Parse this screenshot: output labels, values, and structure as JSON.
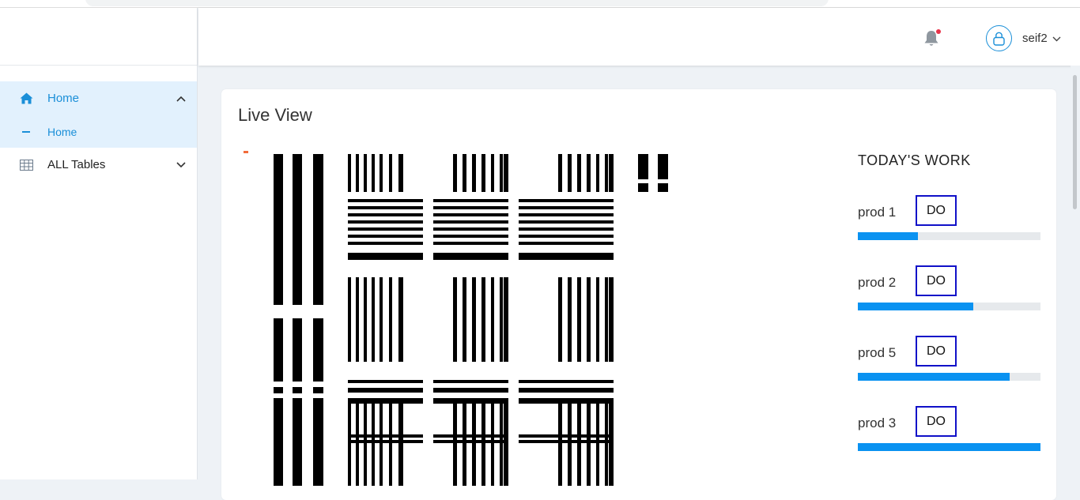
{
  "colors": {
    "accent": "#1a8fd8",
    "progress": "#0a92f1",
    "do_border": "#1010c8",
    "marker": "#f26b3a"
  },
  "sidebar": {
    "items": [
      {
        "label": "Home",
        "icon": "home-icon",
        "expanded": true,
        "children": [
          {
            "label": "Home"
          }
        ]
      },
      {
        "label": "ALL Tables",
        "icon": "table-icon",
        "expanded": false
      }
    ]
  },
  "topbar": {
    "user": {
      "name": "seif2"
    },
    "notifications": {
      "icon": "bell-icon",
      "has_unread": true
    }
  },
  "card": {
    "title": "Live View"
  },
  "work": {
    "title": "TODAY'S WORK",
    "items": [
      {
        "name": "prod 1",
        "button": "DO",
        "progress": 0.33
      },
      {
        "name": "prod 2",
        "button": "DO",
        "progress": 0.63
      },
      {
        "name": "prod 5",
        "button": "DO",
        "progress": 0.83
      },
      {
        "name": "prod 3",
        "button": "DO",
        "progress": 1.0
      }
    ]
  }
}
